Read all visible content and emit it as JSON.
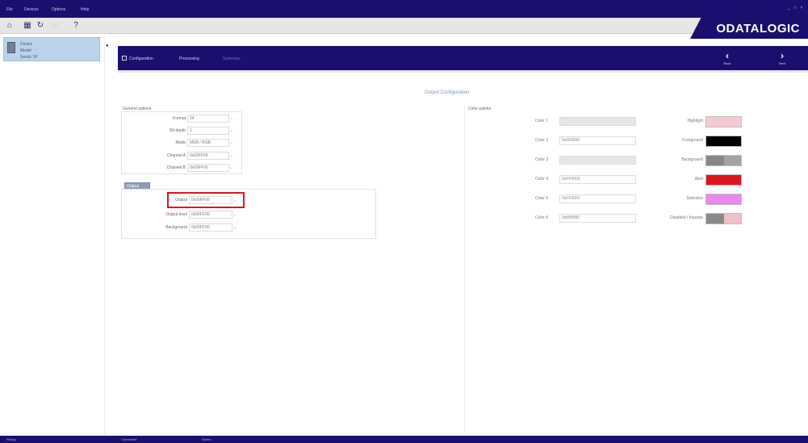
{
  "menu": {
    "items": [
      "File",
      "Devices",
      "Options",
      "Help"
    ],
    "window_controls": [
      "_",
      "□",
      "×"
    ]
  },
  "toolbar": {
    "icons": [
      "home-icon",
      "save-icon",
      "refresh-icon",
      "disabled-icon",
      "help-icon"
    ],
    "glyphs": [
      "⌂",
      "▦",
      "↻",
      "◌",
      "?"
    ]
  },
  "brand": {
    "name": "ODATALOGIC"
  },
  "device": {
    "lines": [
      "Device",
      "Model",
      "Serial / IP"
    ]
  },
  "wizard": {
    "steps": [
      "Configuration",
      "Processing",
      "Summary"
    ],
    "back_label": "Back",
    "next_label": "Next"
  },
  "page": {
    "title": "Output Configuration",
    "left_group_label": "General options",
    "right_group_label": "Color palette",
    "section_badge": "Output"
  },
  "general_options": [
    {
      "label": "Format",
      "value": "24"
    },
    {
      "label": "Bit depth",
      "value": "1"
    },
    {
      "label": "Mode",
      "value": "MSB / RGB"
    },
    {
      "label": "Channel A",
      "value": "0x00FF00"
    },
    {
      "label": "Channel B",
      "value": "0x00FF00"
    }
  ],
  "output_options": [
    {
      "label": "Output",
      "value": "0x00FF00"
    },
    {
      "label": "Output level",
      "value": "0x00FF00"
    },
    {
      "label": "Background",
      "value": "0x00FF00"
    }
  ],
  "palette": [
    {
      "label": "Color 1",
      "value": "",
      "name": "Highlight",
      "filled": true,
      "colors": [
        "#f6c9d2",
        "#f6c9d2"
      ]
    },
    {
      "label": "Color 2",
      "value": "0x000000",
      "name": "Foreground",
      "filled": false,
      "colors": [
        "#000000",
        "#000000"
      ]
    },
    {
      "label": "Color 3",
      "value": "",
      "name": "Background",
      "filled": true,
      "colors": [
        "#878787",
        "#a3a3a3"
      ]
    },
    {
      "label": "Color 4",
      "value": "0xFF0000",
      "name": "Alert",
      "filled": false,
      "colors": [
        "#e0141e",
        "#e0141e"
      ]
    },
    {
      "label": "Color 5",
      "value": "0xFF00FF",
      "name": "Selection",
      "filled": false,
      "colors": [
        "#ef86ef",
        "#ef86ef"
      ]
    },
    {
      "label": "Color 6",
      "value": "0x808080",
      "name": "Disabled / Inactive",
      "filled": false,
      "colors": [
        "#8a8a8a",
        "#f0c0c8"
      ]
    }
  ],
  "status": {
    "items": [
      "Ready",
      "Connected",
      "Online"
    ]
  },
  "colors": {
    "brand_navy": "#1a0f6e",
    "highlight_red": "#e0141e",
    "section_badge": "#8f9db8",
    "device_card": "#b9d4ea"
  }
}
